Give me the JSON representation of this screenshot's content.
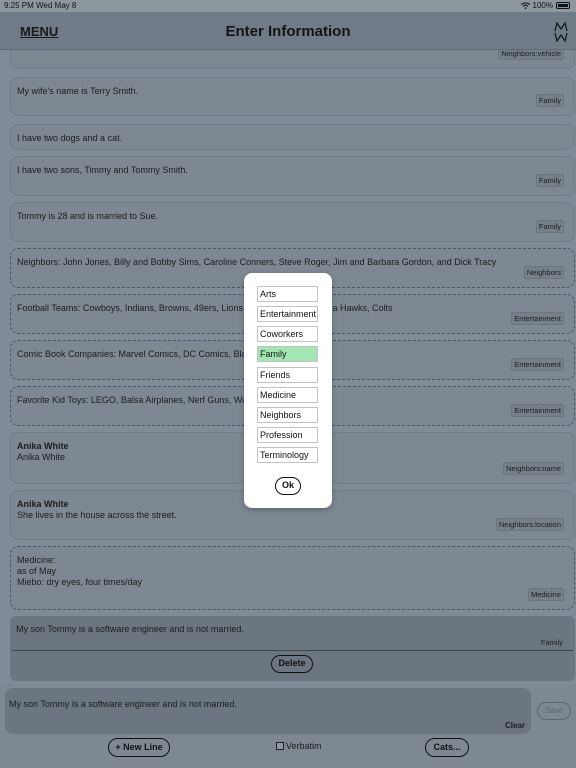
{
  "status_bar": {
    "time": "9:25 PM",
    "date": "Wed May 8",
    "battery": "100%"
  },
  "header": {
    "menu_label": "MENU",
    "title": "Enter Information",
    "logo": "mw-logo-icon"
  },
  "entries": [
    {
      "text": "",
      "tag": "Neighbors:vehicle",
      "dashed": false
    },
    {
      "text": "My wife's name is Terry Smith.",
      "tag": "Family",
      "dashed": false
    },
    {
      "text": "I have two dogs and a cat.",
      "tag": "",
      "dashed": false
    },
    {
      "text": "I have two sons, Timmy and Tommy Smith.",
      "tag": "Family",
      "dashed": false
    },
    {
      "text": "Tommy is 28 and is married to Sue.",
      "tag": "Family",
      "dashed": false
    },
    {
      "text": "Neighbors: John Jones, Billy and Bobby Sims, Caroline Conners, Steve Roger, Jim and Barbara Gordon, and Dick Tracy",
      "tag": "Neighbors",
      "dashed": true
    },
    {
      "text": "Football Teams: Cowboys, Indians, Browns, 49ers, Lions,                          ackers, Chargers, Sea Hawks, Colts",
      "tag": "Entertainment",
      "dashed": true
    },
    {
      "text": "Comic Book Companies: Marvel Comics, DC Comics, Bla                              ge Comics",
      "tag": "Entertainment",
      "dashed": true
    },
    {
      "text": "Favorite Kid Toys: LEGO, Balsa Airplanes, Nerf Guns, Wa                            ky, Rubic Cube",
      "tag": "Entertainment",
      "dashed": true
    },
    {
      "title": "Anika White",
      "text": "Anika White",
      "tag": "Neighbors:name",
      "dashed": false
    },
    {
      "title": "Anika White",
      "text": "She lives in the house across the street.",
      "tag": "Neighbors:location",
      "dashed": false
    },
    {
      "text": "Medicine:\nas of May\nMiebo: dry eyes, four times/day",
      "tag": "Medicine",
      "dashed": true
    }
  ],
  "selected_entry": {
    "text": "My son Tommy is a software engineer and is not married.",
    "tag": "Family",
    "delete_label": "Delete"
  },
  "input": {
    "value": "My son Tommy is a software engineer and is not married.",
    "clear_label": "Clear"
  },
  "buttons": {
    "save": "Save",
    "new_line": "+ New Line",
    "verbatim": "Verbatim",
    "cats": "Cats..."
  },
  "category_picker": {
    "options": [
      "Arts",
      "Entertainment",
      "Coworkers",
      "Family",
      "Friends",
      "Medicine",
      "Neighbors",
      "Profession",
      "Terminology"
    ],
    "selected": "Family",
    "ok_label": "Ok",
    "highlight_color": "#a2e6b4"
  }
}
